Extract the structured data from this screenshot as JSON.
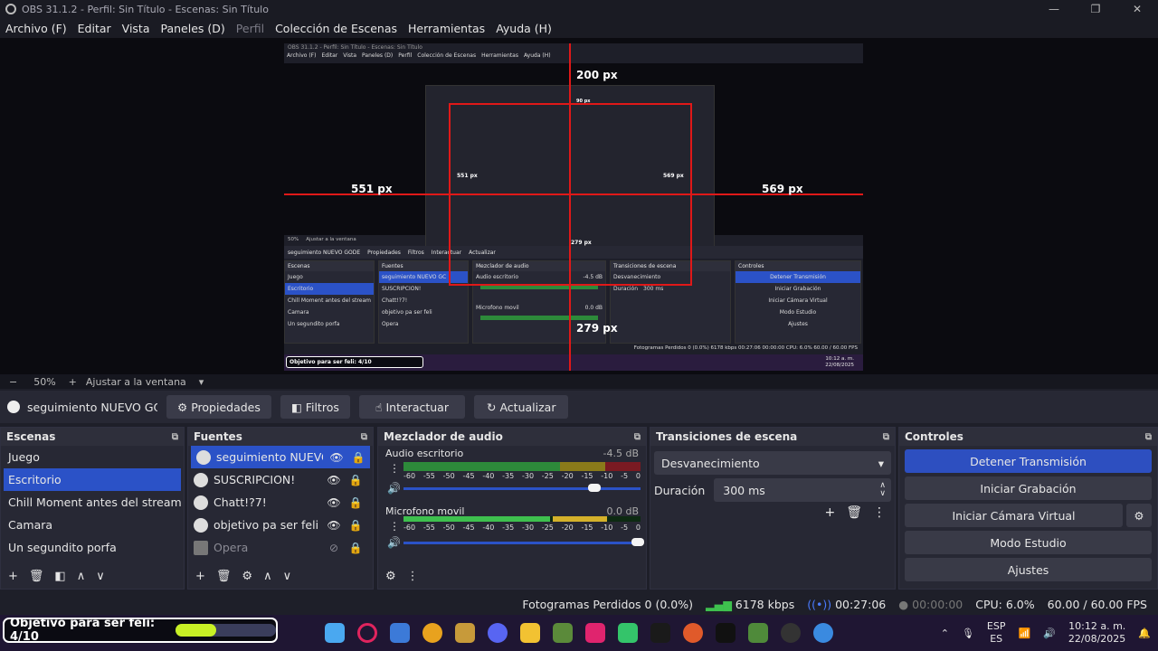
{
  "window": {
    "title": "OBS 31.1.2 - Perfil: Sin Título - Escenas: Sin Título",
    "minimize": "—",
    "maximize": "❐",
    "close": "✕"
  },
  "menu": [
    "Archivo (F)",
    "Editar",
    "Vista",
    "Paneles (D)",
    "Perfil",
    "Colección de Escenas",
    "Herramientas",
    "Ayuda (H)"
  ],
  "preview": {
    "inner_title": "OBS 31.1.2 - Perfil: Sin Título - Escenas: Sin Título",
    "inner_menu": [
      "Archivo (F)",
      "Editar",
      "Vista",
      "Paneles (D)",
      "Perfil",
      "Colección de Escenas",
      "Herramientas",
      "Ayuda (H)"
    ],
    "dims": {
      "top": "200 px",
      "left": "551 px",
      "right": "569 px",
      "bottom": "279 px"
    },
    "inner_dims": {
      "top": "200 px",
      "left": "551 px",
      "right": "569 px",
      "bottom": "279 px",
      "inner_top": "90 px"
    },
    "inner_zoom": "50%",
    "inner_fit": "Ajustar a la ventana",
    "inner_status": "Fotogramas Perdidos 0 (0.0%)   6178 kbps   00:27:06   00:00:00   CPU: 6.0%   60.00 / 60.00 FPS"
  },
  "zoom": {
    "minus": "−",
    "level": "50%",
    "plus": "+",
    "fit": "Ajustar a la ventana",
    "arrow": "▾"
  },
  "source_toolbar": {
    "source_name": "seguimiento NUEVO GODE",
    "properties": "Propiedades",
    "filters": "Filtros",
    "interact": "Interactuar",
    "refresh": "Actualizar"
  },
  "scenes": {
    "title": "Escenas",
    "items": [
      "Juego",
      "Escritorio",
      "Chill Moment antes del stream",
      "Camara",
      "Un segundito porfa"
    ],
    "selected": 1
  },
  "sources": {
    "title": "Fuentes",
    "items": [
      {
        "name": "seguimiento NUEVO GC",
        "selected": true,
        "hidden": false
      },
      {
        "name": "SUSCRIPCION!",
        "selected": false,
        "hidden": false
      },
      {
        "name": "Chatt!?7!",
        "selected": false,
        "hidden": false
      },
      {
        "name": "objetivo pa ser feli",
        "selected": false,
        "hidden": false
      },
      {
        "name": "Opera",
        "selected": false,
        "hidden": true
      }
    ]
  },
  "mixer": {
    "title": "Mezclador de audio",
    "channels": [
      {
        "name": "Audio escritorio",
        "db": "-4.5 dB",
        "level": 0.78,
        "volume": 0.78
      },
      {
        "name": "Microfono movil",
        "db": "0.0 dB",
        "level": 0.62,
        "volume": 0.98
      }
    ],
    "ticks": [
      "-60",
      "-55",
      "-50",
      "-45",
      "-40",
      "-35",
      "-30",
      "-25",
      "-20",
      "-15",
      "-10",
      "-5",
      "0"
    ]
  },
  "transitions": {
    "title": "Transiciones de escena",
    "type": "Desvanecimiento",
    "duration_label": "Duración",
    "duration": "300 ms"
  },
  "controls": {
    "title": "Controles",
    "buttons": [
      "Detener Transmisión",
      "Iniciar Grabación",
      "Iniciar Cámara Virtual",
      "Modo Estudio",
      "Ajustes"
    ]
  },
  "status": {
    "dropped": "Fotogramas Perdidos 0 (0.0%)",
    "bitrate": "6178 kbps",
    "stream_time": "00:27:06",
    "rec_time": "00:00:00",
    "cpu": "CPU: 6.0%",
    "fps": "60.00 / 60.00 FPS"
  },
  "goal": {
    "text": "Objetivo para ser feli: 4/10",
    "progress": 0.4
  },
  "tray": {
    "lang": "ESP",
    "region": "ES",
    "time": "10:12 a. m.",
    "date": "22/08/2025",
    "arrow": "⌃"
  },
  "colors": {
    "accent": "#2b52c7",
    "green": "#2d8a3a",
    "red_guide": "#e01818",
    "goal_fill": "#c8f025"
  }
}
